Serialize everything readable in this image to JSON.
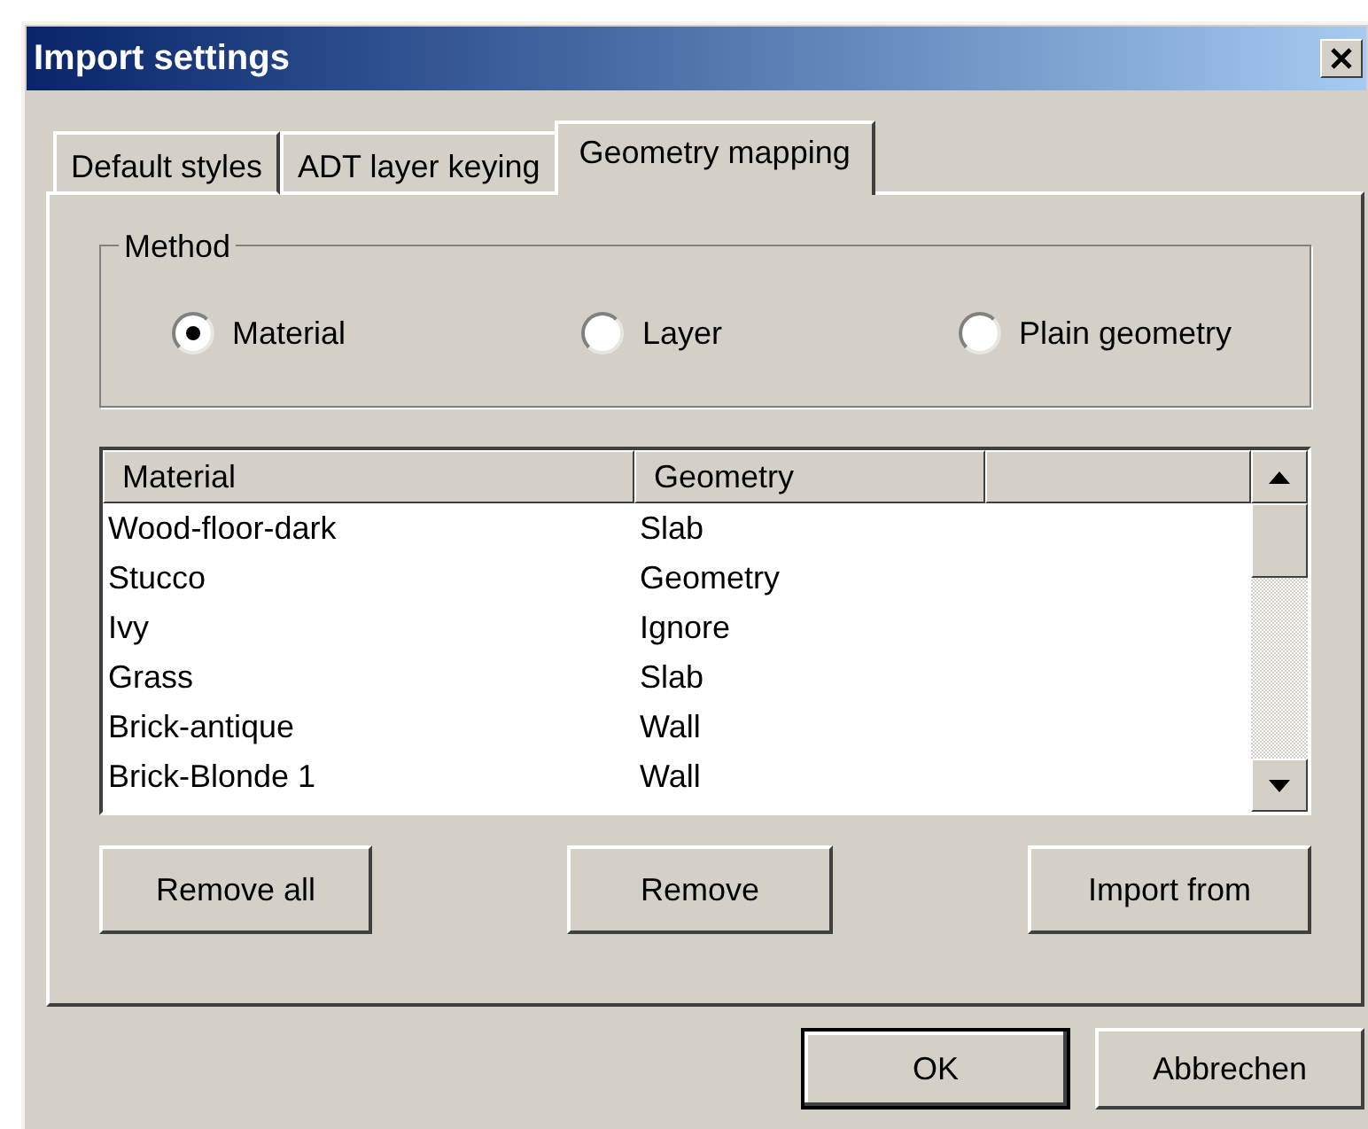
{
  "window": {
    "title": "Import settings"
  },
  "tabs": [
    {
      "label": "Default styles",
      "selected": false
    },
    {
      "label": "ADT layer keying",
      "selected": false
    },
    {
      "label": "Geometry mapping",
      "selected": true
    }
  ],
  "method": {
    "legend": "Method",
    "options": [
      {
        "label": "Material",
        "selected": true
      },
      {
        "label": "Layer",
        "selected": false
      },
      {
        "label": "Plain geometry",
        "selected": false
      }
    ]
  },
  "table": {
    "columns": [
      "Material",
      "Geometry"
    ],
    "rows": [
      [
        "Wood-floor-dark",
        "Slab"
      ],
      [
        "Stucco",
        "Geometry"
      ],
      [
        "Ivy",
        "Ignore"
      ],
      [
        "Grass",
        "Slab"
      ],
      [
        "Brick-antique",
        "Wall"
      ],
      [
        "Brick-Blonde 1",
        "Wall"
      ]
    ]
  },
  "list_buttons": [
    "Remove all",
    "Remove",
    "Import from"
  ],
  "dialog_buttons": [
    {
      "label": "OK",
      "default": true
    },
    {
      "label": "Abbrechen",
      "default": false
    }
  ]
}
